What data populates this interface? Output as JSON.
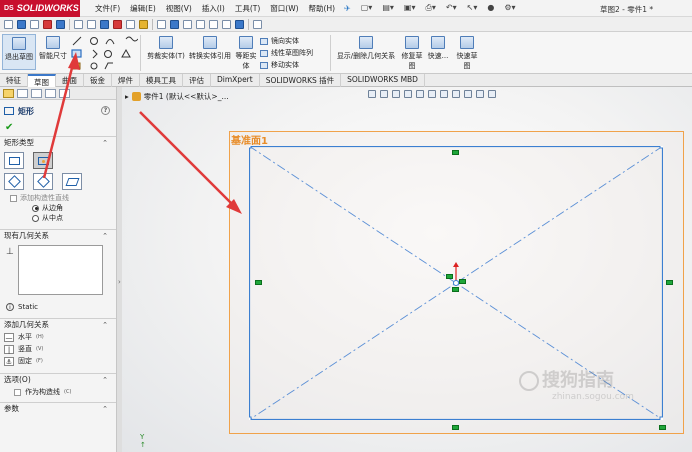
{
  "app": {
    "logo_prefix": "DS",
    "logo_text": "SOLIDWORKS",
    "doc_title": "草图2 - 零件1 *"
  },
  "menu": [
    "文件(F)",
    "编辑(E)",
    "视图(V)",
    "插入(I)",
    "工具(T)",
    "窗口(W)",
    "帮助(H)"
  ],
  "command_manager": {
    "exit_sketch": "退出草图",
    "smart_dim": "智能尺寸",
    "trim": "剪裁实体(T)",
    "convert": "转换实体引用",
    "offset_line1": "等距实",
    "offset_line2": "体",
    "mirror": "镜向实体",
    "linear_pattern": "线性草图阵列",
    "move": "移动实体",
    "relations": "显示/删除几何关系",
    "repair_line1": "修复草",
    "repair_line2": "图",
    "quick_snaps": "快速...",
    "rapid_line1": "快速草",
    "rapid_line2": "图"
  },
  "tabs": [
    "特征",
    "草图",
    "曲面",
    "钣金",
    "焊件",
    "模具工具",
    "评估",
    "DimXpert",
    "SOLIDWORKS 插件",
    "SOLIDWORKS MBD"
  ],
  "active_tab": "草图",
  "property_manager": {
    "title": "矩形",
    "help": "?",
    "ok_symbol": "✔",
    "rect_type_title": "矩形类型",
    "construction_check": "添加构造性直线",
    "from_corner": "从边角",
    "from_center": "从中点",
    "existing_title": "现有几何关系",
    "existing_icon": "⊥",
    "status": "Static",
    "add_relations_title": "添加几何关系",
    "horizontal": "水平",
    "horizontal_key": "(H)",
    "vertical": "竖直",
    "vertical_key": "(V)",
    "fix": "固定",
    "fix_key": "(F)",
    "options_title": "选项(O)",
    "as_construction": "作为构造线",
    "as_construction_key": "(C)",
    "params_title": "参数"
  },
  "tree": {
    "part_label": "零件1 (默认<<默认>_..."
  },
  "canvas": {
    "plane_label": "基准面1"
  },
  "watermark": {
    "text": "搜狗指南",
    "url": "zhinan.sogou.com"
  },
  "axis_label": "Y",
  "colors": {
    "sketch_line": "#3b7fd1",
    "construction": "#5a8fd6",
    "plane_border": "#f0a24a",
    "arrow": "#e03a3a",
    "handle": "#1fa63a",
    "accent": "#c8102e"
  }
}
